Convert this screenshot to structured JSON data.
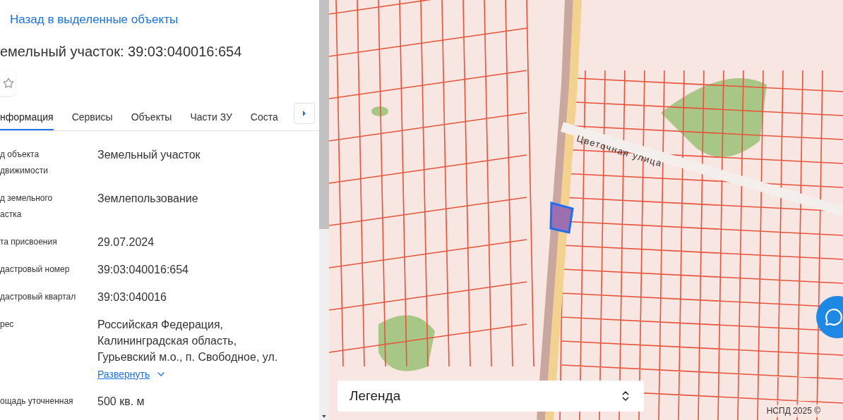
{
  "back_link": "Назад в выделенные объекты",
  "title": "емельный участок: 39:03:040016:654",
  "favorite": {
    "on": false
  },
  "tabs": [
    {
      "label": "нформация",
      "selected": true
    },
    {
      "label": "Сервисы",
      "selected": false
    },
    {
      "label": "Объекты",
      "selected": false
    },
    {
      "label": "Части ЗУ",
      "selected": false
    },
    {
      "label": "Соста",
      "selected": false
    }
  ],
  "fields": [
    {
      "label": [
        "д объекта",
        "движимости"
      ],
      "value": [
        "Земельный участок"
      ]
    },
    {
      "label": [
        "д земельного",
        "астка"
      ],
      "value": [
        "Землепользование"
      ]
    },
    {
      "label": [
        "та присвоения"
      ],
      "value": [
        "29.07.2024"
      ]
    },
    {
      "label": [
        "дастровый номер"
      ],
      "value": [
        "39:03:040016:654"
      ]
    },
    {
      "label": [
        "дастровый квартал"
      ],
      "value": [
        "39:03:040016"
      ]
    },
    {
      "label": [
        "рес"
      ],
      "value": [
        "Российская Федерация,",
        "Калининградская область,",
        "Гурьевский м.о., п. Свободное, ул."
      ],
      "link": "Развернуть"
    },
    {
      "label": [
        "ощадь уточненная"
      ],
      "value": [
        "500 кв. м"
      ]
    }
  ],
  "map": {
    "street_label": "Цветочная улица",
    "legend": "Легенда",
    "attribution": "НСПД 2025 ©"
  }
}
